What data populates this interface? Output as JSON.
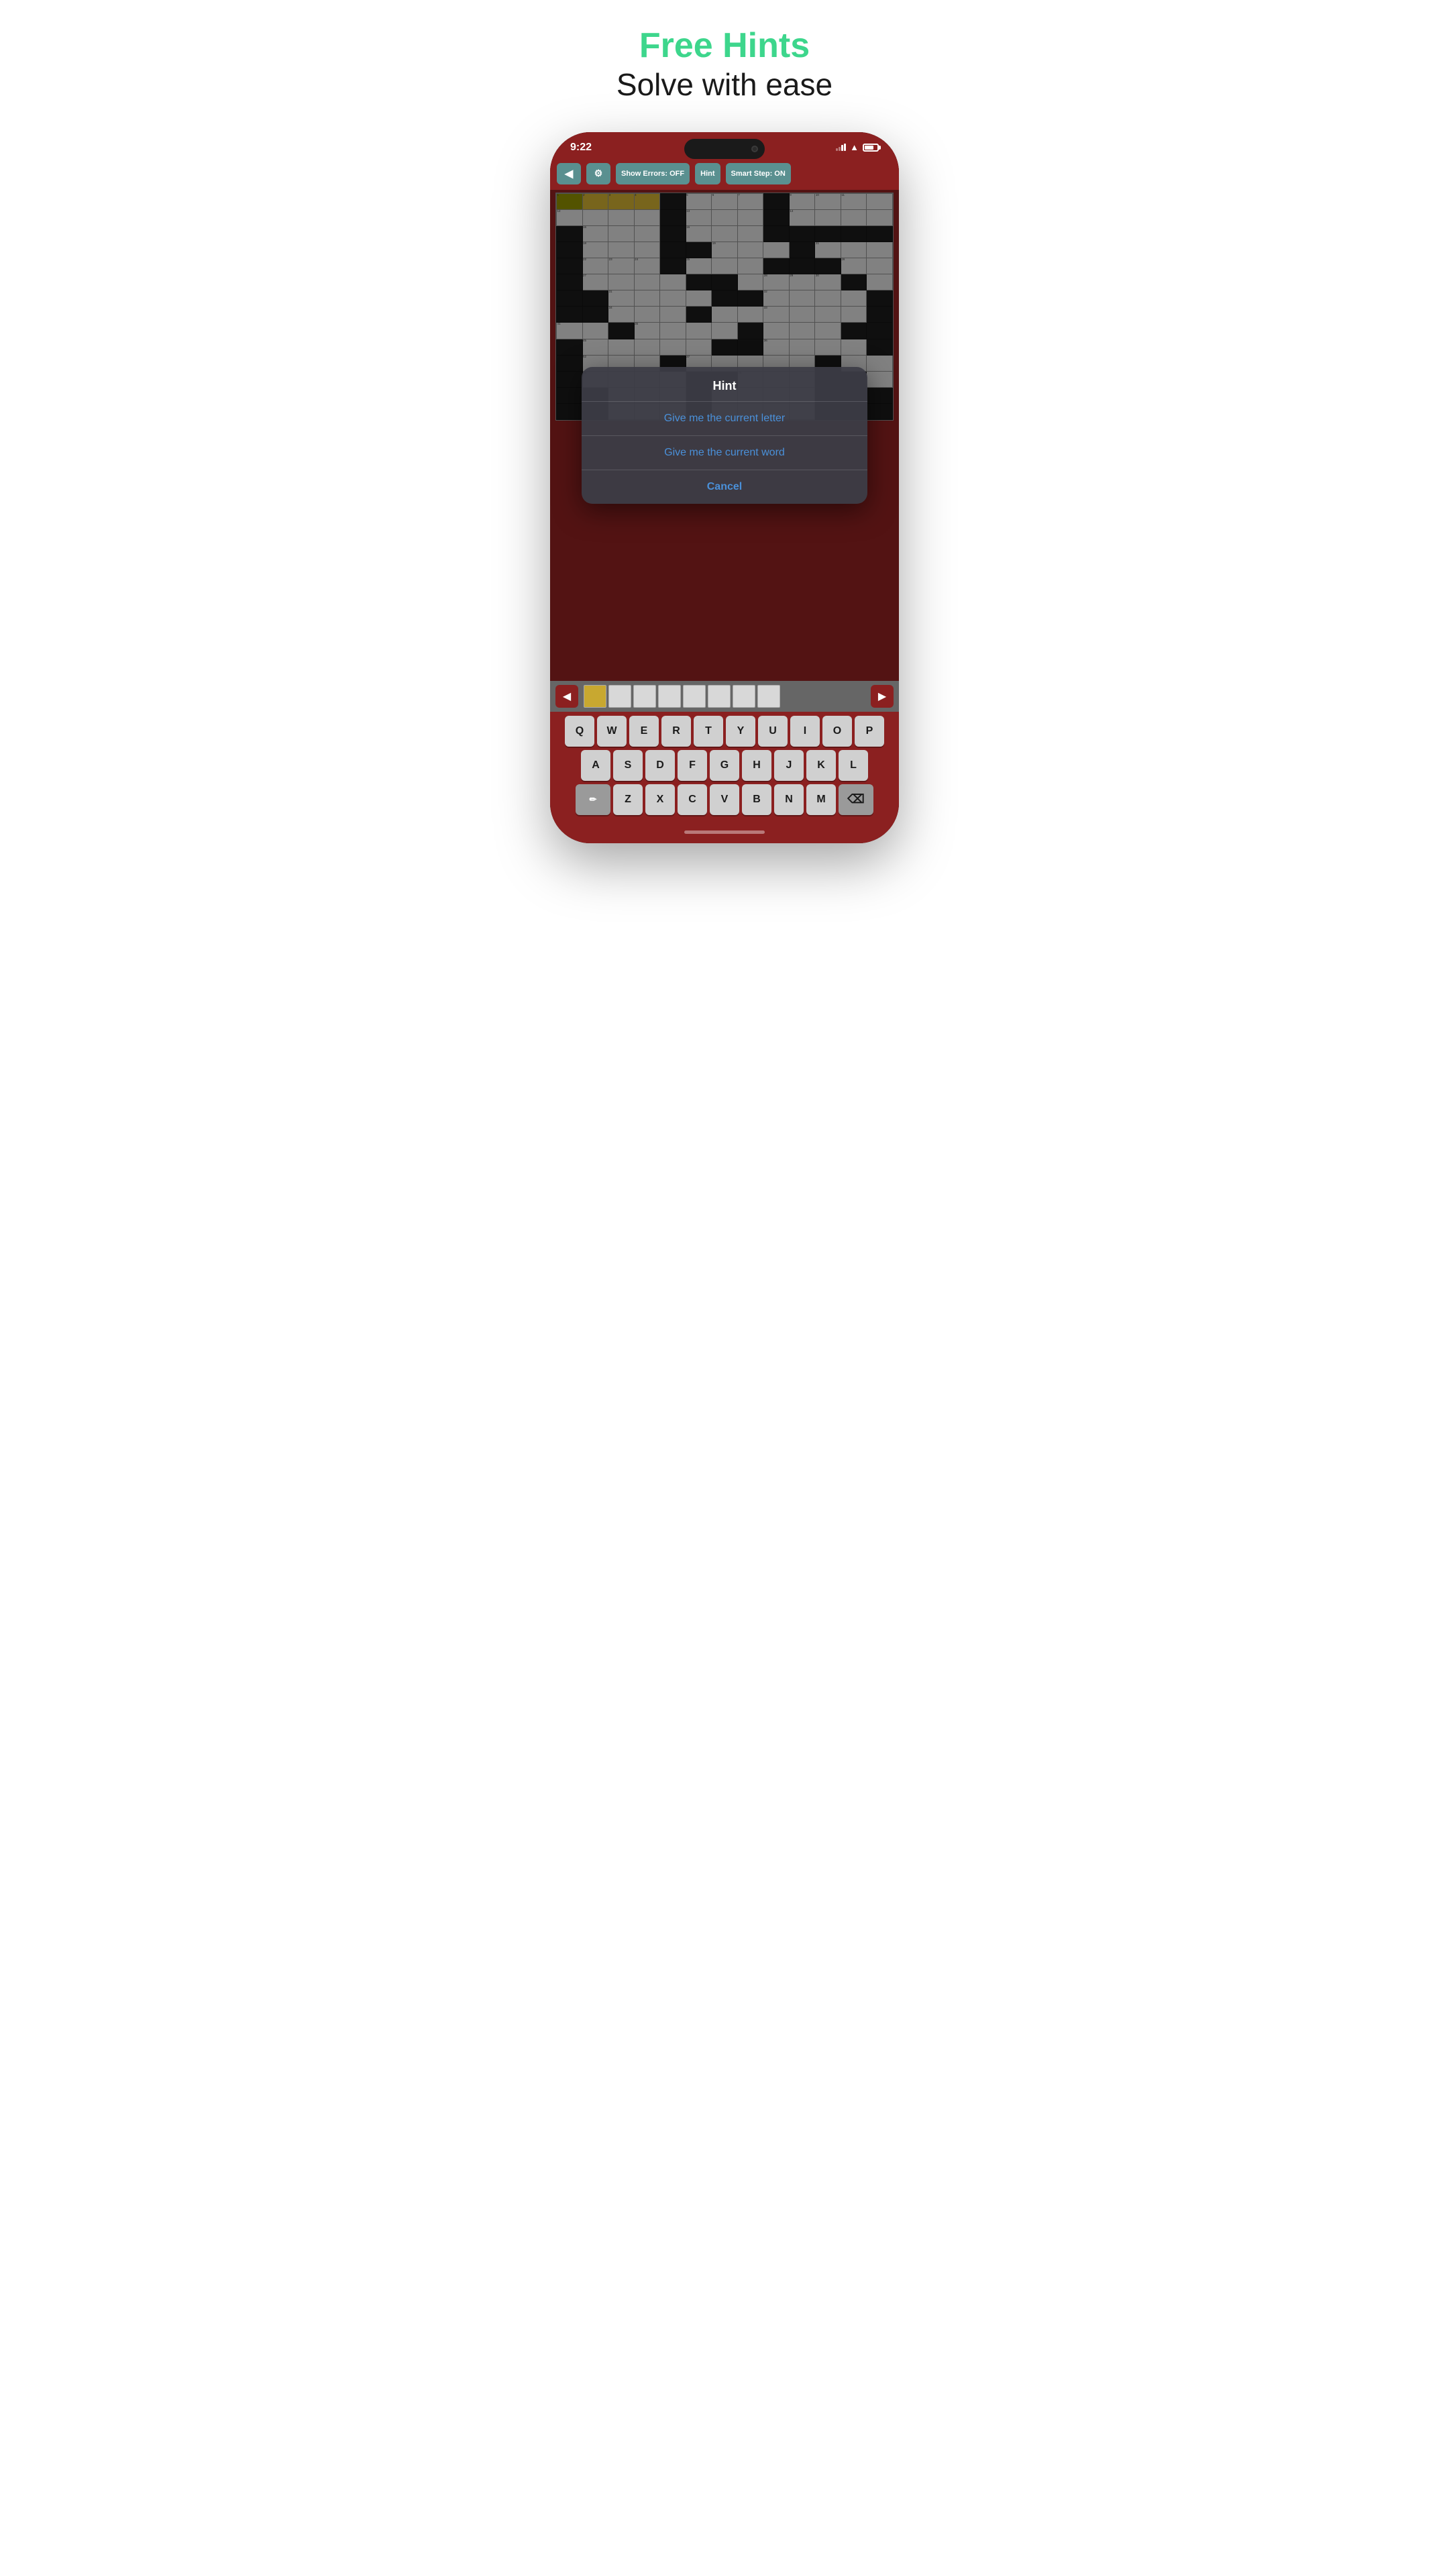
{
  "header": {
    "title_green": "Free Hints",
    "subtitle": "Solve with ease"
  },
  "status_bar": {
    "time": "9:22"
  },
  "toolbar": {
    "back_label": "◀",
    "gear_label": "⚙",
    "show_errors_label": "Show Errors: OFF",
    "hint_label": "Hint",
    "smart_step_label": "Smart Step: ON"
  },
  "dialog": {
    "title": "Hint",
    "option1": "Give me the current letter",
    "option2": "Give me the current word",
    "cancel": "Cancel"
  },
  "keyboard": {
    "row1": [
      "Q",
      "W",
      "E",
      "R",
      "T",
      "Y",
      "U",
      "I",
      "O",
      "P"
    ],
    "row2": [
      "A",
      "S",
      "D",
      "F",
      "G",
      "H",
      "J",
      "K",
      "L"
    ],
    "row3_special_left": "✏",
    "row3": [
      "Z",
      "X",
      "C",
      "V",
      "B",
      "N",
      "M"
    ],
    "row3_delete": "⌫"
  },
  "word_bar": {
    "prev": "◀",
    "next": "▶"
  },
  "grid": {
    "rows": 14,
    "cols": 13,
    "black_cells": [
      [
        0,
        4
      ],
      [
        0,
        8
      ],
      [
        1,
        4
      ],
      [
        1,
        8
      ],
      [
        2,
        0
      ],
      [
        2,
        4
      ],
      [
        2,
        8
      ],
      [
        2,
        9
      ],
      [
        2,
        10
      ],
      [
        2,
        11
      ],
      [
        2,
        12
      ],
      [
        3,
        0
      ],
      [
        3,
        4
      ],
      [
        3,
        5
      ],
      [
        3,
        9
      ],
      [
        4,
        0
      ],
      [
        4,
        4
      ],
      [
        4,
        8
      ],
      [
        4,
        9
      ],
      [
        4,
        10
      ],
      [
        5,
        0
      ],
      [
        5,
        5
      ],
      [
        5,
        6
      ],
      [
        5,
        11
      ],
      [
        6,
        0
      ],
      [
        6,
        1
      ],
      [
        6,
        6
      ],
      [
        6,
        7
      ],
      [
        6,
        12
      ],
      [
        7,
        0
      ],
      [
        7,
        1
      ],
      [
        7,
        5
      ],
      [
        7,
        12
      ],
      [
        8,
        2
      ],
      [
        8,
        7
      ],
      [
        8,
        11
      ],
      [
        8,
        12
      ],
      [
        9,
        0
      ],
      [
        9,
        6
      ],
      [
        9,
        7
      ],
      [
        9,
        12
      ],
      [
        10,
        0
      ],
      [
        10,
        4
      ],
      [
        10,
        10
      ],
      [
        11,
        0
      ],
      [
        11,
        5
      ],
      [
        11,
        6
      ],
      [
        11,
        10
      ],
      [
        11,
        11
      ],
      [
        12,
        0
      ],
      [
        12,
        1
      ],
      [
        12,
        5
      ],
      [
        12,
        10
      ],
      [
        12,
        11
      ],
      [
        12,
        12
      ],
      [
        13,
        0
      ],
      [
        13,
        1
      ],
      [
        13,
        5
      ],
      [
        13,
        10
      ],
      [
        13,
        11
      ],
      [
        13,
        12
      ]
    ],
    "yellow_cells": [
      [
        0,
        1
      ],
      [
        0,
        2
      ],
      [
        0,
        3
      ]
    ],
    "olive_cells": [
      [
        0,
        0
      ]
    ]
  }
}
